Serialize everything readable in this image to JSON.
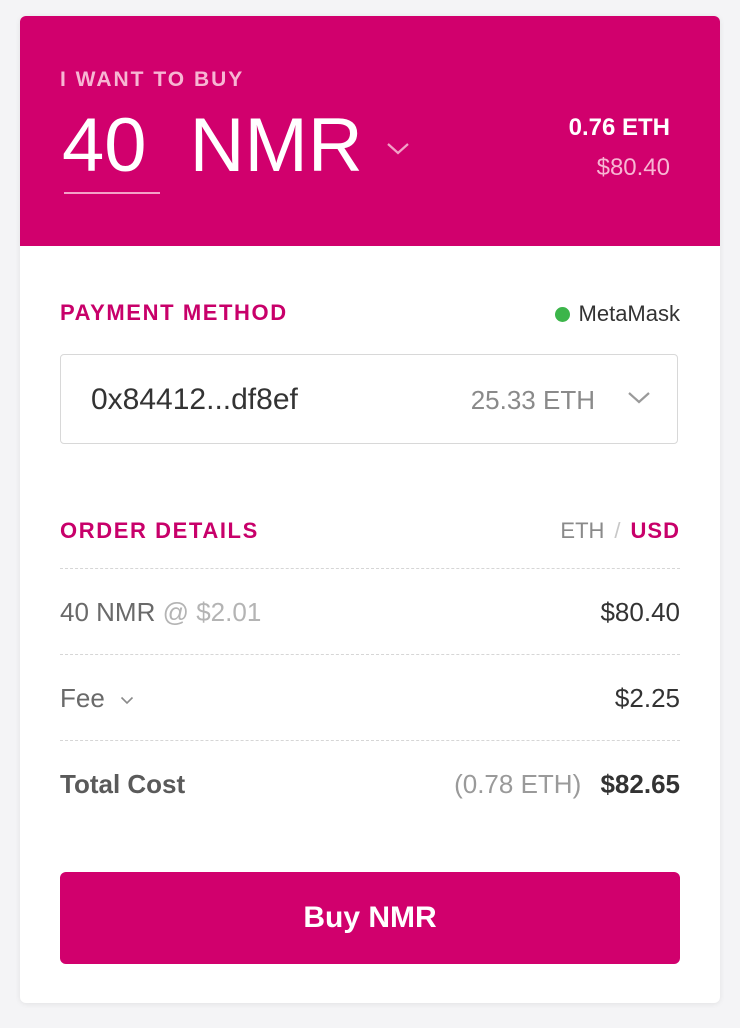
{
  "hero": {
    "label": "I WANT TO BUY",
    "amount": "40",
    "token": "NMR",
    "eth_value": "0.76 ETH",
    "usd_value": "$80.40"
  },
  "payment": {
    "title": "PAYMENT METHOD",
    "wallet_name": "MetaMask",
    "wallet_status_color": "#3cb54a",
    "address": "0x84412...df8ef",
    "balance": "25.33 ETH"
  },
  "order": {
    "title": "ORDER DETAILS",
    "currency_options": [
      "ETH",
      "USD"
    ],
    "currency_separator": "/",
    "selected_currency": "USD",
    "rows": [
      {
        "label": "40 NMR",
        "at": "@ $2.01",
        "value": "$80.40"
      },
      {
        "label": "Fee",
        "value": "$2.25"
      },
      {
        "label": "Total Cost",
        "secondary": "(0.78 ETH)",
        "value": "$82.65"
      }
    ]
  },
  "buy_button_label": "Buy NMR",
  "colors": {
    "brand": "#d1006d",
    "success": "#3cb54a"
  }
}
